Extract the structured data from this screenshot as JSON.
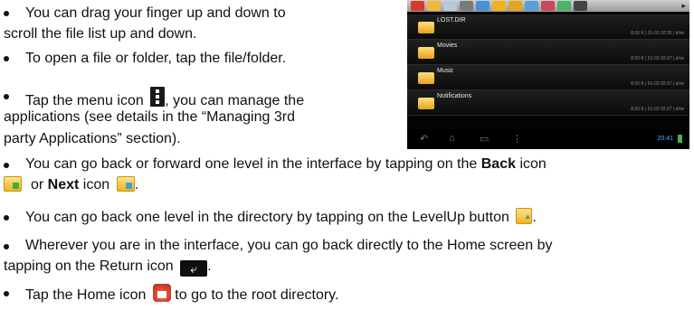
{
  "bullets": {
    "b1_line1": "You can drag your finger up and down to",
    "b1_line2": "scroll the file list up and down.",
    "b2_line1": "To open a file or folder, tap the file/folder.",
    "b3_line1a": "Tap the menu icon ",
    "b3_line1b": ", you can manage the",
    "b3_line2": "applications (see details in the “Managing 3rd",
    "b3_line3": "party Applications” section).",
    "b4_line1a": "You can go back or forward one level in the interface by tapping on the ",
    "b4_back": "Back",
    "b4_line1b": " icon",
    "b4_line2a": "or ",
    "b4_next": "Next",
    "b4_line2b": " icon ",
    "b4_line2c": ".",
    "b5_line1a": "You can go back one level in the directory by tapping on the LevelUp button ",
    "b5_line1b": ".",
    "b6_line1": "Wherever you are in the interface, you can go back directly to the Home screen by",
    "b6_line2a": "tapping on the Return icon ",
    "b6_line2b": ".",
    "b7_line1a": "Tap the Home icon ",
    "b7_line1b": " to go to the root directory."
  },
  "icons": {
    "menu": "menu-icon",
    "back": "back-folder-icon",
    "next": "next-folder-icon",
    "levelup": "levelup-icon",
    "return": "return-icon",
    "home": "home-icon"
  },
  "phone": {
    "rows": [
      {
        "name": "LOST.DIR",
        "meta": "8.00 K | 01-03 02:36 | d/rw"
      },
      {
        "name": "Movies",
        "meta": "8.00 K | 01-03 02:37 | d/rw"
      },
      {
        "name": "Music",
        "meta": "8.00 K | 01-03 02:37 | d/rw"
      },
      {
        "name": "Notifications",
        "meta": "8.00 K | 01-03 02:37 | d/rw"
      }
    ],
    "time": "20:41",
    "toolbar_colors": [
      "#d63a2a",
      "#f0b83a",
      "#b6c9d8",
      "#7a7a7a",
      "#4a8fd8",
      "#f2b21f",
      "#e4a520",
      "#5a9ed6",
      "#c84a5a",
      "#4bb36a",
      "#444444"
    ]
  }
}
